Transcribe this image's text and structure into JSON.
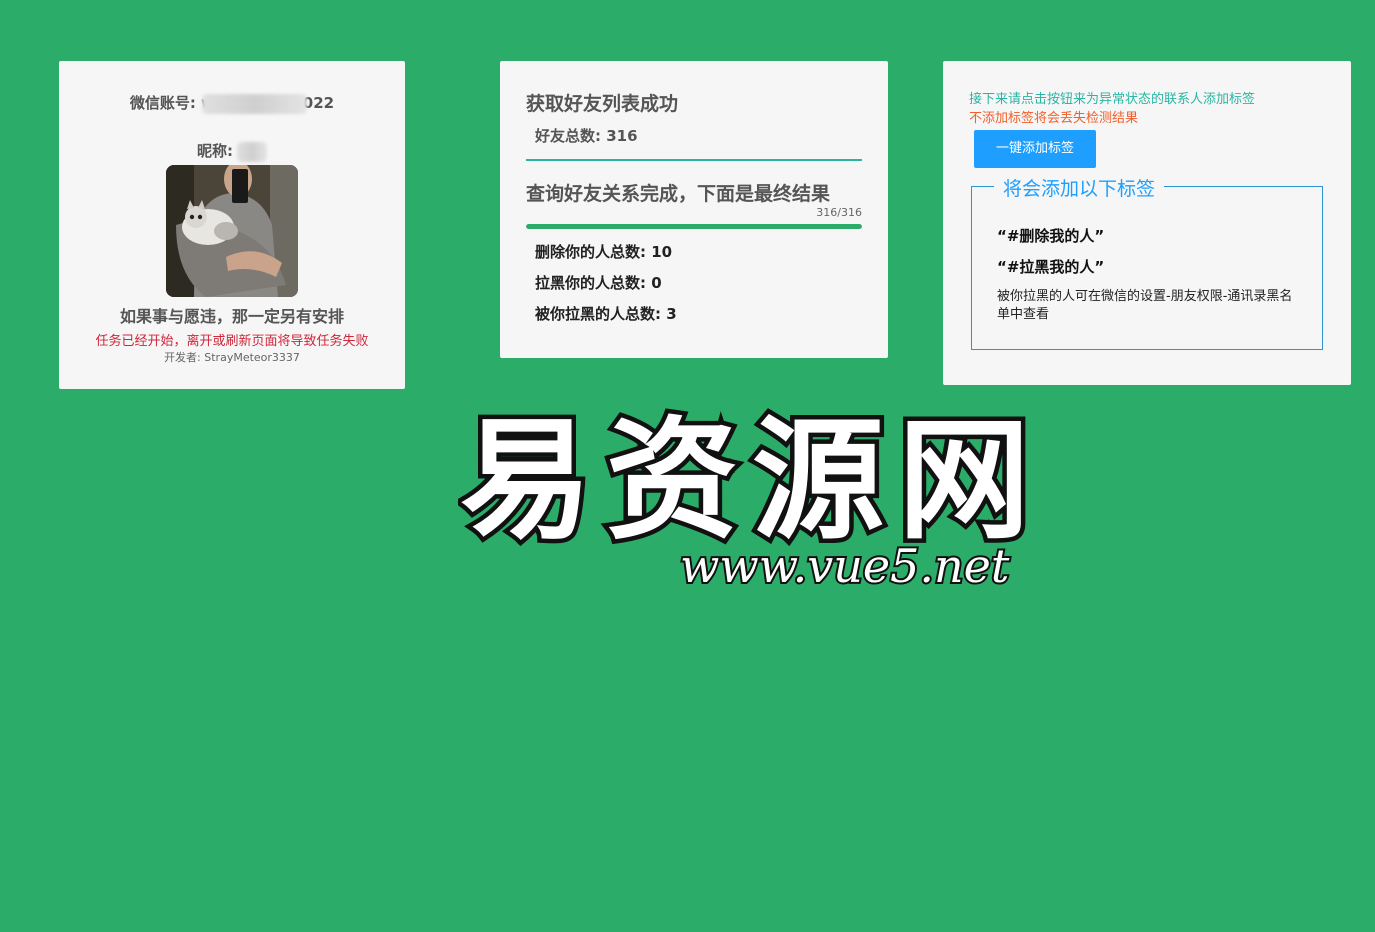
{
  "profile": {
    "account_label": "微信账号: wxi",
    "account_suffix": "022",
    "nickname_label": "昵称:",
    "motto": "如果事与愿违，那一定另有安排",
    "warning": "任务已经开始，离开或刷新页面将导致任务失败",
    "developer": "开发者: StrayMeteor3337"
  },
  "results": {
    "fetch_title": "获取好友列表成功",
    "friend_total": "好友总数: 316",
    "query_title": "查询好友关系完成，下面是最终结果",
    "progress_text": "316/316",
    "progress_fraction": 1.0,
    "deleted_me": "删除你的人总数: 10",
    "blocked_me": "拉黑你的人总数: 0",
    "blocked_by_you": "被你拉黑的人总数: 3"
  },
  "tags": {
    "tip_line1": "接下来请点击按钮来为异常状态的联系人添加标签",
    "tip_line2": "不添加标签将会丢失检测结果",
    "add_button": "一键添加标签",
    "legend": "将会添加以下标签",
    "tag1": "“#删除我的人”",
    "tag2": "“#拉黑我的人”",
    "note": "被你拉黑的人可在微信的设置-朋友权限-通讯录黑名单中查看"
  },
  "watermark": {
    "brand": "易资源网",
    "url": "www.vue5.net"
  },
  "colors": {
    "background": "#2bad69",
    "card": "#f6f6f6",
    "teal": "#2bb5a3",
    "warning_red": "#d0263a",
    "orange": "#f0602c",
    "button_blue": "#1e9fff"
  }
}
